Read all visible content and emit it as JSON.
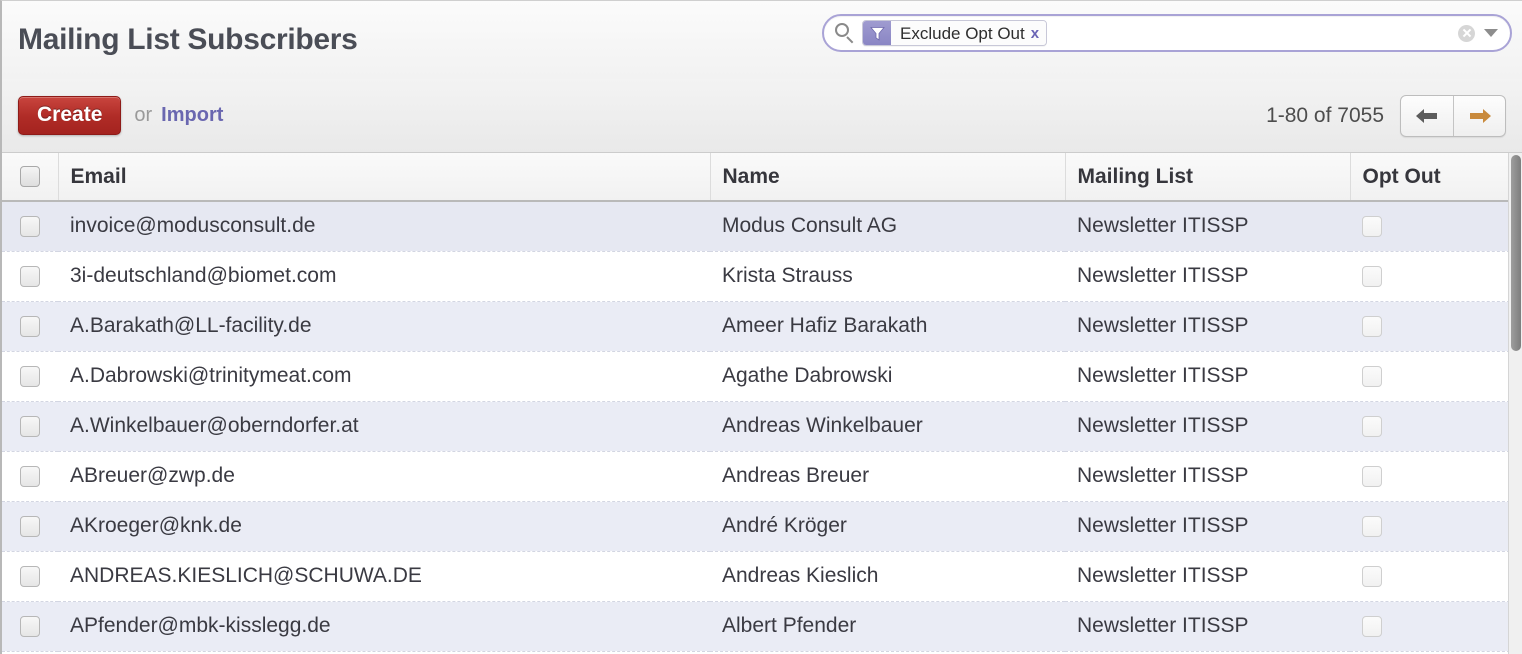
{
  "header": {
    "title": "Mailing List Subscribers"
  },
  "search": {
    "search_icon": "search-icon",
    "facet": {
      "icon": "filter-funnel-icon",
      "label": "Exclude Opt Out",
      "remove_label": "x"
    },
    "clear_icon": "clear-circle-icon",
    "dropdown_icon": "chevron-down-icon"
  },
  "toolbar": {
    "create_label": "Create",
    "or_label": "or",
    "import_label": "Import",
    "pager": {
      "count_label": "1-80 of 7055",
      "prev_icon": "arrow-left-icon",
      "next_icon": "arrow-right-icon"
    }
  },
  "table": {
    "columns": [
      {
        "key": "check",
        "label": ""
      },
      {
        "key": "email",
        "label": "Email"
      },
      {
        "key": "name",
        "label": "Name"
      },
      {
        "key": "list",
        "label": "Mailing List"
      },
      {
        "key": "opt",
        "label": "Opt Out"
      }
    ],
    "rows": [
      {
        "email": "invoice@modusconsult.de",
        "name": "Modus Consult AG",
        "list": "Newsletter ITISSP",
        "opt_out": false
      },
      {
        "email": "3i-deutschland@biomet.com",
        "name": "Krista Strauss",
        "list": "Newsletter ITISSP",
        "opt_out": false
      },
      {
        "email": "A.Barakath@LL-facility.de",
        "name": "Ameer Hafiz Barakath",
        "list": "Newsletter ITISSP",
        "opt_out": false
      },
      {
        "email": "A.Dabrowski@trinitymeat.com",
        "name": "Agathe Dabrowski",
        "list": "Newsletter ITISSP",
        "opt_out": false
      },
      {
        "email": "A.Winkelbauer@oberndorfer.at",
        "name": "Andreas Winkelbauer",
        "list": "Newsletter ITISSP",
        "opt_out": false
      },
      {
        "email": "ABreuer@zwp.de",
        "name": "Andreas Breuer",
        "list": "Newsletter ITISSP",
        "opt_out": false
      },
      {
        "email": "AKroeger@knk.de",
        "name": "André Kröger",
        "list": "Newsletter ITISSP",
        "opt_out": false
      },
      {
        "email": "ANDREAS.KIESLICH@SCHUWA.DE",
        "name": "Andreas Kieslich",
        "list": "Newsletter ITISSP",
        "opt_out": false
      },
      {
        "email": "APfender@mbk-kisslegg.de",
        "name": "Albert Pfender",
        "list": "Newsletter ITISSP",
        "opt_out": false
      }
    ]
  },
  "colors": {
    "create_button": "#b02c27",
    "link": "#6a67b0",
    "facet_accent": "#8a86c4",
    "row_alt": "#eaecf5",
    "next_arrow": "#c98a3c",
    "prev_arrow": "#5c5c5c"
  }
}
